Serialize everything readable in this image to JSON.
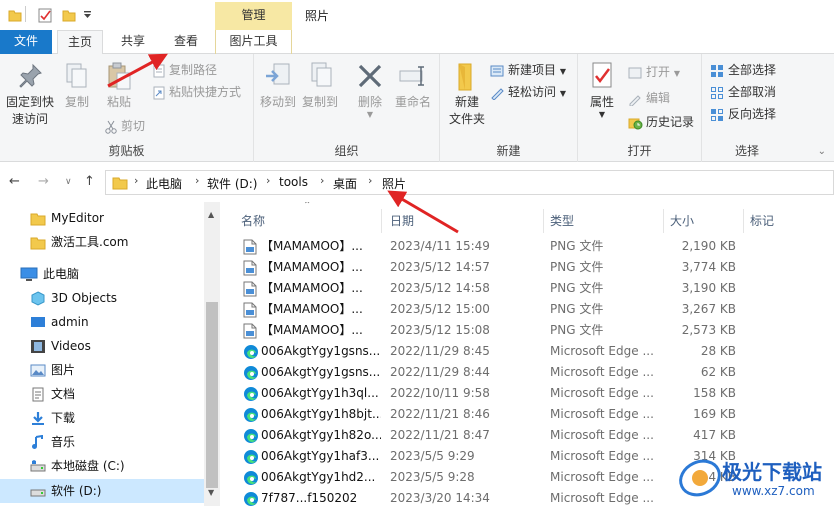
{
  "window": {
    "title": "照片",
    "context_tab": "管理"
  },
  "tabs": [
    "文件",
    "主页",
    "共享",
    "查看",
    "图片工具"
  ],
  "ribbon": {
    "clipboard": {
      "label": "剪贴板",
      "pin": "固定到快速访问",
      "pin_line1": "固定到快",
      "pin_line2": "速访问",
      "copy": "复制",
      "paste": "粘贴",
      "copy_path": "复制路径",
      "paste_shortcut": "粘贴快捷方式",
      "cut": "剪切"
    },
    "organize": {
      "label": "组织",
      "move_to": "移动到",
      "copy_to": "复制到",
      "delete": "删除",
      "rename": "重命名"
    },
    "new": {
      "label": "新建",
      "new_folder_line1": "新建",
      "new_folder_line2": "文件夹",
      "new_item": "新建项目",
      "easy_access": "轻松访问"
    },
    "open": {
      "label": "打开",
      "properties": "属性",
      "open": "打开",
      "edit": "编辑",
      "history": "历史记录"
    },
    "select": {
      "label": "选择",
      "select_all": "全部选择",
      "select_none": "全部取消",
      "invert": "反向选择"
    }
  },
  "address": {
    "crumbs": [
      "此电脑",
      "软件 (D:)",
      "tools",
      "桌面",
      "照片"
    ]
  },
  "nav_pane": {
    "items": [
      {
        "label": "MyEditor",
        "icon": "folder-icon"
      },
      {
        "label": "激活工具.com",
        "icon": "folder-icon"
      },
      {
        "label": "此电脑",
        "icon": "computer-icon"
      },
      {
        "label": "3D Objects",
        "icon": "3d-objects-icon"
      },
      {
        "label": "admin",
        "icon": "desktop-icon"
      },
      {
        "label": "Videos",
        "icon": "videos-icon"
      },
      {
        "label": "图片",
        "icon": "pictures-icon"
      },
      {
        "label": "文档",
        "icon": "documents-icon"
      },
      {
        "label": "下载",
        "icon": "downloads-icon"
      },
      {
        "label": "音乐",
        "icon": "music-icon"
      },
      {
        "label": "本地磁盘 (C:)",
        "icon": "drive-c-icon"
      },
      {
        "label": "软件 (D:)",
        "icon": "drive-d-icon",
        "selected": true
      }
    ]
  },
  "file_list": {
    "columns": {
      "name": "名称",
      "date": "日期",
      "type": "类型",
      "size": "大小",
      "tags": "标记"
    },
    "rows": [
      {
        "name": "【MAMAMOO】...",
        "date": "2023/4/11 15:49",
        "type": "PNG 文件",
        "size": "2,190 KB",
        "icon": "png-file-icon"
      },
      {
        "name": "【MAMAMOO】...",
        "date": "2023/5/12 14:57",
        "type": "PNG 文件",
        "size": "3,774 KB",
        "icon": "png-file-icon"
      },
      {
        "name": "【MAMAMOO】...",
        "date": "2023/5/12 14:58",
        "type": "PNG 文件",
        "size": "3,190 KB",
        "icon": "png-file-icon"
      },
      {
        "name": "【MAMAMOO】...",
        "date": "2023/5/12 15:00",
        "type": "PNG 文件",
        "size": "3,267 KB",
        "icon": "png-file-icon"
      },
      {
        "name": "【MAMAMOO】...",
        "date": "2023/5/12 15:08",
        "type": "PNG 文件",
        "size": "2,573 KB",
        "icon": "png-file-icon"
      },
      {
        "name": "006AkgtYgy1gsns...",
        "date": "2022/11/29 8:45",
        "type": "Microsoft Edge ...",
        "size": "28 KB",
        "icon": "edge-file-icon"
      },
      {
        "name": "006AkgtYgy1gsns...",
        "date": "2022/11/29 8:44",
        "type": "Microsoft Edge ...",
        "size": "62 KB",
        "icon": "edge-file-icon"
      },
      {
        "name": "006AkgtYgy1h3ql...",
        "date": "2022/10/11 9:58",
        "type": "Microsoft Edge ...",
        "size": "158 KB",
        "icon": "edge-file-icon"
      },
      {
        "name": "006AkgtYgy1h8bjt...",
        "date": "2022/11/21 8:46",
        "type": "Microsoft Edge ...",
        "size": "169 KB",
        "icon": "edge-file-icon"
      },
      {
        "name": "006AkgtYgy1h82o...",
        "date": "2022/11/21 8:47",
        "type": "Microsoft Edge ...",
        "size": "417 KB",
        "icon": "edge-file-icon"
      },
      {
        "name": "006AkgtYgy1haf3...",
        "date": "2023/5/5 9:29",
        "type": "Microsoft Edge ...",
        "size": "314 KB",
        "icon": "edge-file-icon"
      },
      {
        "name": "006AkgtYgy1hd2...",
        "date": "2023/5/5 9:28",
        "type": "Microsoft Edge ...",
        "size": "4 KB",
        "icon": "edge-file-icon"
      },
      {
        "name": "7f787...f150202",
        "date": "2023/3/20 14:34",
        "type": "Microsoft Edge ...",
        "size": "",
        "icon": "edge-file-icon"
      }
    ]
  },
  "watermark": {
    "name": "极光下载站",
    "url": "www.xz7.com"
  },
  "colors": {
    "file_tab": "#1979ca",
    "context_tab": "#f7e8a4",
    "selection": "#cce8ff",
    "annotation_arrow": "#e02424"
  }
}
